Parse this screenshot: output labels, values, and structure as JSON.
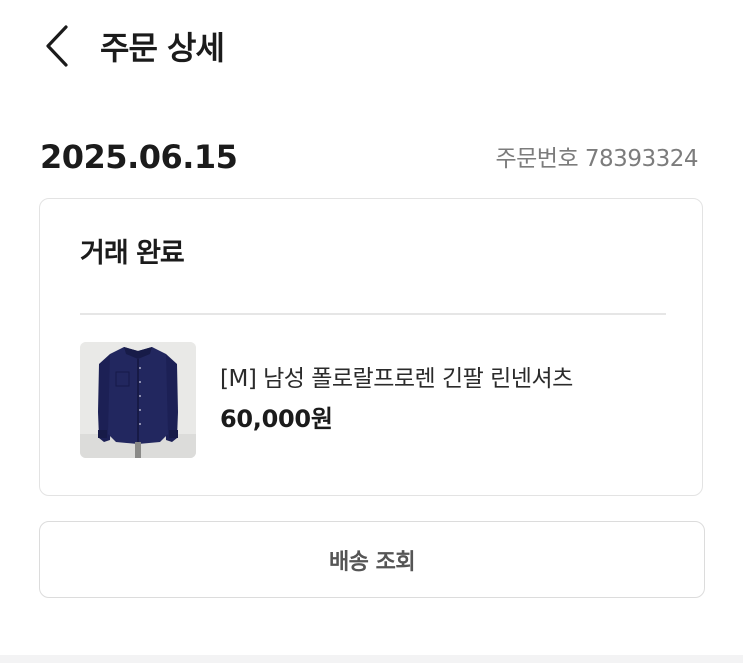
{
  "header": {
    "back_icon": "chevron-left-icon",
    "title": "주문 상세"
  },
  "order": {
    "date": "2025.06.15",
    "number_label": "주문번호 78393324"
  },
  "card": {
    "status": "거래 완료",
    "product": {
      "name": "[M] 남성 폴로랄프로렌 긴팔 린넨셔츠",
      "price": "60,000원",
      "image_icon": "navy-shirt-photo"
    }
  },
  "actions": {
    "tracking_label": "배송 조회"
  },
  "colors": {
    "text_primary": "#1b1b1b",
    "text_secondary": "#7c7c7c",
    "border": "#e3e3e3",
    "shirt": "#1e2257"
  }
}
